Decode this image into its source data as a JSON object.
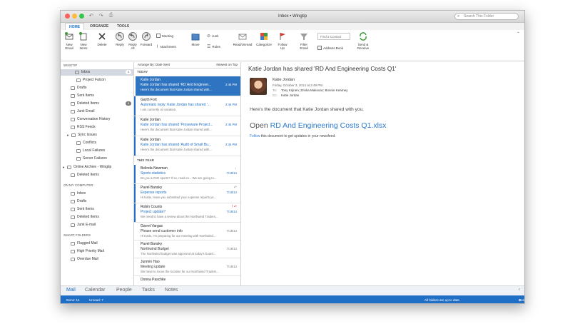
{
  "window": {
    "title": "Inbox • Wingtip",
    "search_placeholder": "Search This Folder"
  },
  "tabs": [
    "HOME",
    "ORGANIZE",
    "TOOLS"
  ],
  "ribbon": {
    "new_email": "New\nEmail",
    "new_items": "New\nItems",
    "delete": "Delete",
    "reply": "Reply",
    "reply_all": "Reply\nAll",
    "forward": "Forward",
    "meeting": "Meeting",
    "attachment": "Attachment",
    "move": "Move",
    "junk": "Junk",
    "rules": "Rules",
    "read_unread": "Read/Unread",
    "categorize": "Categorize",
    "follow_up": "Follow\nUp",
    "filter_email": "Filter\nEmail",
    "find_contact": "Find a Contact",
    "address_book": "Address Book",
    "send_receive": "Send &\nReceive"
  },
  "sidebar": {
    "account1": "WINGTIP",
    "inbox": "Inbox",
    "inbox_count": "2",
    "project_falcon": "Project Falcon",
    "drafts": "Drafts",
    "sent": "Sent Items",
    "deleted": "Deleted Items",
    "deleted_count": "8",
    "junk": "Junk Email",
    "conversation_history": "Conversation History",
    "rss": "RSS Feeds",
    "sync_issues": "Sync Issues",
    "conflicts": "Conflicts",
    "local_failures": "Local Failures",
    "server_failures": "Server Failures",
    "online_archive": "Online Archive - Wingtip",
    "archive_deleted": "Deleted Items",
    "on_my_computer": "ON MY COMPUTER",
    "omc_inbox": "Inbox",
    "omc_drafts": "Drafts",
    "omc_sent": "Sent Items",
    "omc_deleted": "Deleted Items",
    "omc_junk": "Junk E-mail",
    "smart_folders": "SMART FOLDERS",
    "flagged": "Flagged Mail",
    "high_priority": "High Priority Mail",
    "overdue": "Overdue Mail"
  },
  "list": {
    "arrange": "Arrange By: Date Sent",
    "order": "Newest on Top",
    "group_today": "TODAY",
    "group_year": "THIS YEAR",
    "messages": [
      {
        "from": "Katie Jordan",
        "subject": "Katie Jordan has shared 'RD And Engineer...",
        "preview": "Here's the document that Katie Jordan shared with...",
        "date": "2:46 PM"
      },
      {
        "from": "Garth Fort",
        "subject": "Automatic reply: Katie Jordan has shared '...",
        "preview": "I am currently on vacation.",
        "date": "2:46 PM"
      },
      {
        "from": "Katie Jordan",
        "subject": "Katie Jordan has shared 'Proseware Project...",
        "preview": "Here's the document that Katie Jordan shared with...",
        "date": "2:45 PM"
      },
      {
        "from": "Katie Jordan",
        "subject": "Katie Jordan has shared 'Audit of Small Bu...",
        "preview": "Here's the document that Katie Jordan shared with...",
        "date": "2:45 PM"
      },
      {
        "from": "Belinda Newman",
        "subject": "Sports statistics",
        "preview": "Do you LOVE sports? If so, read on... We are going to...",
        "date": "7/18/14"
      },
      {
        "from": "Pavel Bansky",
        "subject": "Expense reports",
        "preview": "Hi Katie, Have you submitted your expense reports ye...",
        "date": "7/18/14"
      },
      {
        "from": "Robin Counts",
        "subject": "Project update?",
        "preview": "We need to have a review about the Northwind Traders...",
        "date": "7/18/14"
      },
      {
        "from": "Garret Vargas",
        "subject": "Please send customer info",
        "preview": "Hi Katie, I'm preparing for our meeting with Northwind...",
        "date": "7/18/14"
      },
      {
        "from": "Pavel Bansky",
        "subject": "Northwind Budget",
        "preview": "The Northwind budget was approved at today's board...",
        "date": "7/18/14"
      },
      {
        "from": "Junmin Hao",
        "subject": "Meeting update",
        "preview": "We have to move the location for our Northwind Traders...",
        "date": "7/18/14"
      },
      {
        "from": "Donna Paschke",
        "subject": "",
        "preview": "",
        "date": ""
      }
    ]
  },
  "reading": {
    "subject": "Katie Jordan has shared 'RD And Engineering Costs Q1'",
    "sender": "Katie Jordan",
    "date": "Friday, October 3, 2014 at 2:49 PM",
    "to_label": "To:",
    "to": "Tony Krijnen;  Zrinka Makovac;  Bonnie Kearney",
    "cc_label": "Cc:",
    "cc": "Katie Jordan",
    "body": "Here's the document that Katie Jordan shared with you.",
    "open_prefix": "Open ",
    "open_doc": "RD And Engineering Costs Q1.xlsx",
    "follow_link": "Follow",
    "follow_text": " this document to get updates in your newsfeed."
  },
  "nav": [
    "Mail",
    "Calendar",
    "People",
    "Tasks",
    "Notes"
  ],
  "status": {
    "items": "Items: 14",
    "unread": "Unread: 7",
    "uptodate": "All folders are up to date.",
    "connected": "Connected to: Wingtip"
  },
  "colors": {
    "accent": "#1f6fc7",
    "selected_row": "#2f74c0",
    "link": "#2b7bd0"
  }
}
